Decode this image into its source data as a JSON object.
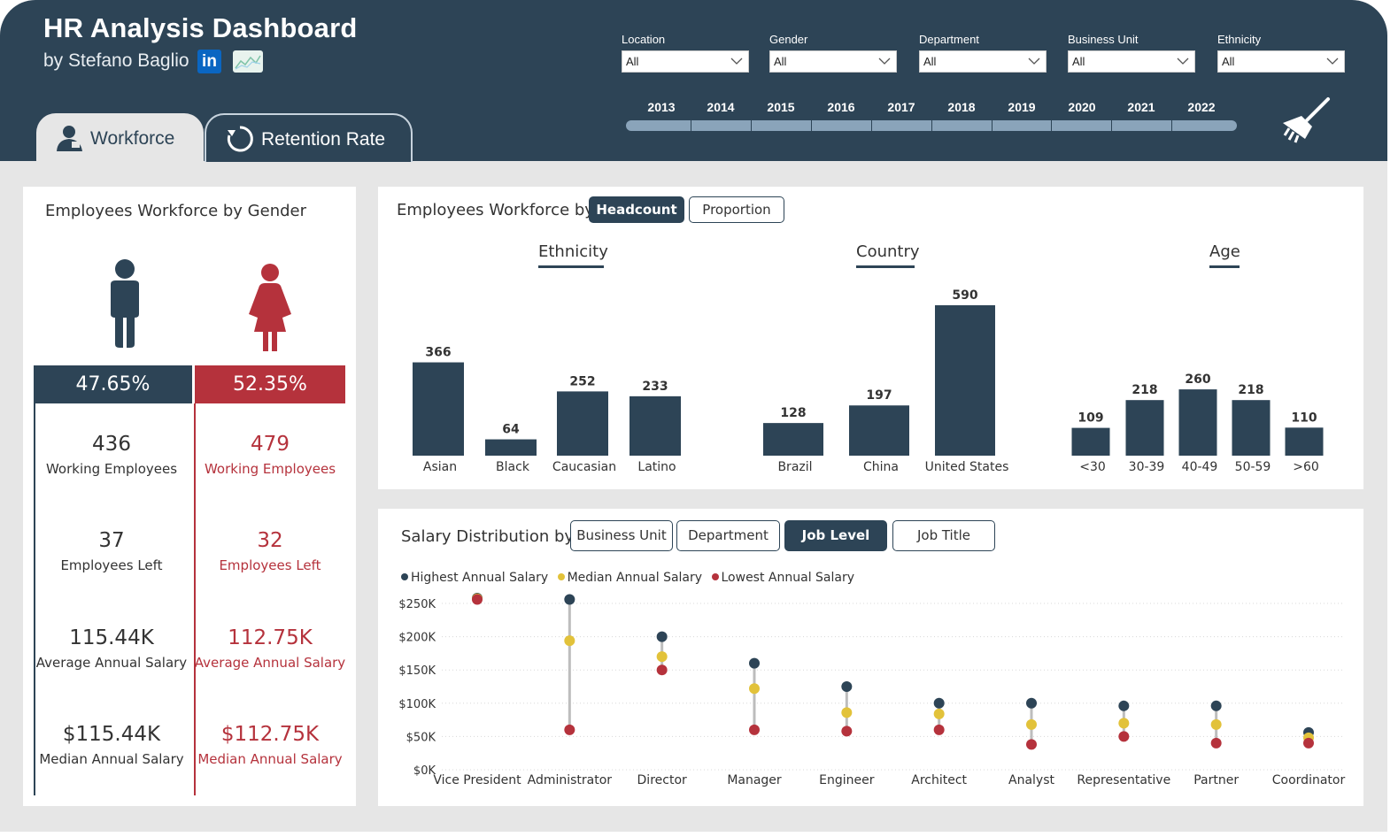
{
  "header": {
    "title": "HR Analysis Dashboard",
    "author": "by Stefano Baglio",
    "linkedin_icon_text": "in"
  },
  "filters": [
    {
      "label": "Location",
      "value": "All"
    },
    {
      "label": "Gender",
      "value": "All"
    },
    {
      "label": "Department",
      "value": "All"
    },
    {
      "label": "Business Unit",
      "value": "All"
    },
    {
      "label": "Ethnicity",
      "value": "All"
    }
  ],
  "years": [
    "2013",
    "2014",
    "2015",
    "2016",
    "2017",
    "2018",
    "2019",
    "2020",
    "2021",
    "2022"
  ],
  "tabs": [
    {
      "label": "Workforce",
      "icon": "user-icon",
      "active": true
    },
    {
      "label": "Retention Rate",
      "icon": "circle-arrow-icon",
      "active": false
    }
  ],
  "gender_panel": {
    "title": "Employees Workforce by Gender",
    "male": {
      "color": "#2d4456",
      "percent": "47.65%",
      "working": "436",
      "working_label": "Working Employees",
      "left": "37",
      "left_label": "Employees Left",
      "avg_salary": "115.44K",
      "avg_salary_label": "Average Annual Salary",
      "median_salary": "$115.44K",
      "median_salary_label": "Median Annual Salary"
    },
    "female": {
      "color": "#b5323c",
      "percent": "52.35%",
      "working": "479",
      "working_label": "Working Employees",
      "left": "32",
      "left_label": "Employees Left",
      "avg_salary": "112.75K",
      "avg_salary_label": "Average Annual Salary",
      "median_salary": "$112.75K",
      "median_salary_label": "Median Annual Salary"
    }
  },
  "workforce_panel": {
    "title": "Employees Workforce by",
    "toggles": [
      {
        "label": "Headcount",
        "active": true
      },
      {
        "label": "Proportion",
        "active": false
      }
    ],
    "sections": [
      "Ethnicity",
      "Country",
      "Age"
    ]
  },
  "salary_panel": {
    "title": "Salary Distribution by",
    "toggles": [
      {
        "label": "Business Unit",
        "active": false
      },
      {
        "label": "Department",
        "active": false
      },
      {
        "label": "Job Level",
        "active": true
      },
      {
        "label": "Job Title",
        "active": false
      }
    ],
    "legend": [
      {
        "label": "Highest Annual Salary",
        "color": "#2d4456"
      },
      {
        "label": "Median Annual Salary",
        "color": "#e2c23a"
      },
      {
        "label": "Lowest Annual Salary",
        "color": "#b5323c"
      }
    ]
  },
  "chart_data": [
    {
      "type": "bar",
      "title": "Ethnicity",
      "categories": [
        "Asian",
        "Black",
        "Caucasian",
        "Latino"
      ],
      "values": [
        366,
        64,
        252,
        233
      ],
      "color": "#2d4456"
    },
    {
      "type": "bar",
      "title": "Country",
      "categories": [
        "Brazil",
        "China",
        "United States"
      ],
      "values": [
        128,
        197,
        590
      ],
      "color": "#2d4456"
    },
    {
      "type": "bar",
      "title": "Age",
      "categories": [
        "<30",
        "30-39",
        "40-49",
        "50-59",
        ">60"
      ],
      "values": [
        109,
        218,
        260,
        218,
        110
      ],
      "color": "#2d4456"
    },
    {
      "type": "scatter",
      "categories": [
        "Vice President",
        "Administrator",
        "Director",
        "Manager",
        "Engineer",
        "Architect",
        "Analyst",
        "Representative",
        "Partner",
        "Coordinator"
      ],
      "series": [
        {
          "name": "Highest Annual Salary",
          "color": "#2d4456",
          "values": [
            258000,
            256000,
            200000,
            160000,
            125000,
            100000,
            100000,
            96000,
            96000,
            56000
          ]
        },
        {
          "name": "Median Annual Salary",
          "color": "#e2c23a",
          "values": [
            257000,
            194000,
            170000,
            122000,
            86000,
            84000,
            68000,
            70000,
            68000,
            48000
          ]
        },
        {
          "name": "Lowest Annual Salary",
          "color": "#b5323c",
          "values": [
            256000,
            60000,
            150000,
            60000,
            58000,
            60000,
            38000,
            50000,
            40000,
            40000
          ]
        }
      ],
      "yticks": [
        "$0K",
        "$50K",
        "$100K",
        "$150K",
        "$200K",
        "$250K"
      ],
      "ylim": [
        0,
        250000
      ],
      "grid": true,
      "legend": "top-left"
    }
  ]
}
